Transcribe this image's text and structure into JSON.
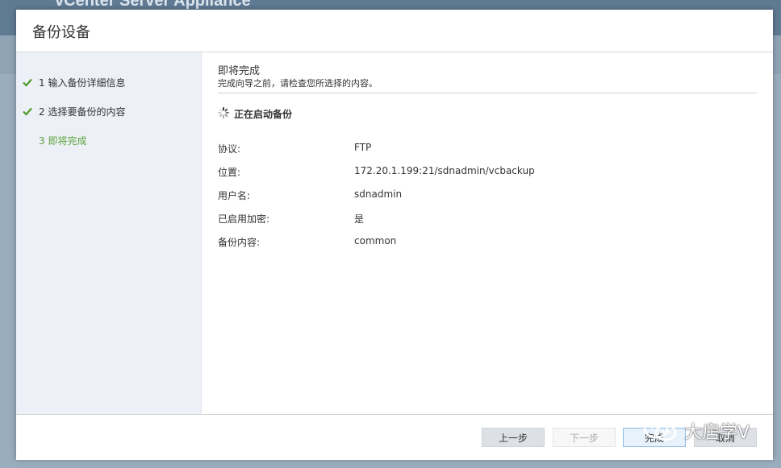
{
  "background": {
    "app_title": "vCenter Server Appliance"
  },
  "dialog": {
    "title": "备份设备",
    "steps": [
      {
        "label": "1 输入备份详细信息",
        "done": true
      },
      {
        "label": "2 选择要备份的内容",
        "done": true
      },
      {
        "label": "3 即将完成",
        "done": false,
        "active": true
      }
    ],
    "page_title": "即将完成",
    "page_subtitle": "完成向导之前，请检查您所选择的内容。",
    "status_text": "正在启动备份",
    "details": [
      {
        "key": "协议:",
        "value": "FTP"
      },
      {
        "key": "位置:",
        "value": "172.20.1.199:21/sdnadmin/vcbackup"
      },
      {
        "key": "用户名:",
        "value": "sdnadmin"
      },
      {
        "key": "已启用加密:",
        "value": "是"
      },
      {
        "key": "备份内容:",
        "value": "common"
      }
    ],
    "buttons": {
      "prev": "上一步",
      "next": "下一步",
      "finish": "完成",
      "cancel": "取消"
    }
  },
  "watermark": {
    "text": "大扂学V"
  },
  "colors": {
    "accent_green": "#5aa33a",
    "check_green": "#4a9a2a"
  }
}
